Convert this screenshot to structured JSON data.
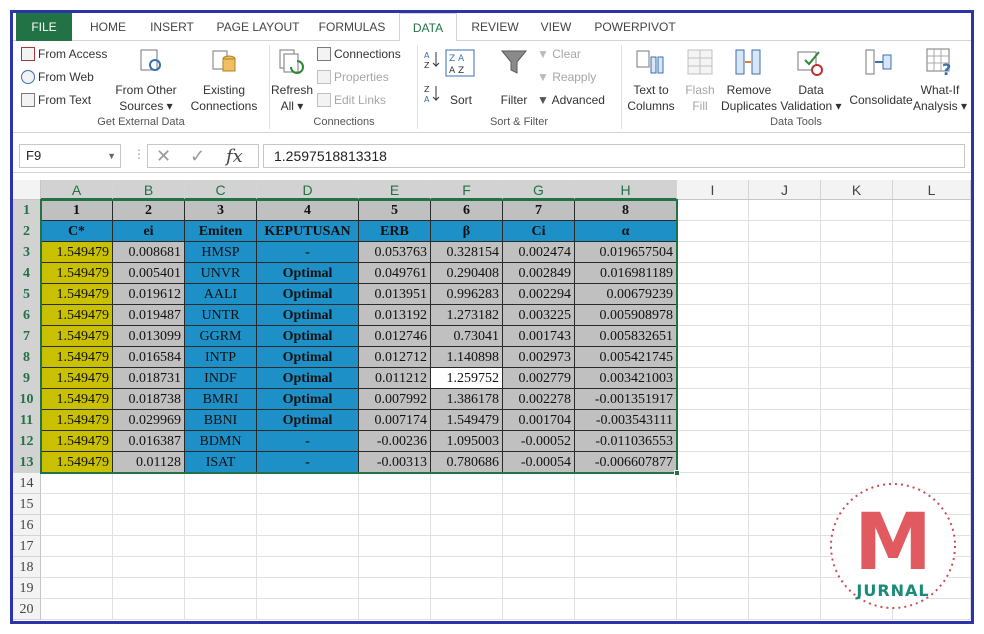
{
  "ribbon": {
    "tabs": [
      "FILE",
      "HOME",
      "INSERT",
      "PAGE LAYOUT",
      "FORMULAS",
      "DATA",
      "REVIEW",
      "VIEW",
      "POWERPIVOT"
    ],
    "get_external": {
      "from_access": "From Access",
      "from_web": "From Web",
      "from_text": "From Text",
      "from_other_1": "From Other",
      "from_other_2": "Sources ▾",
      "existing_1": "Existing",
      "existing_2": "Connections",
      "label": "Get External Data"
    },
    "connections": {
      "refresh_1": "Refresh",
      "refresh_2": "All ▾",
      "connections": "Connections",
      "properties": "Properties",
      "edit_links": "Edit Links",
      "label": "Connections"
    },
    "sort_filter": {
      "sort": "Sort",
      "filter": "Filter",
      "clear": "Clear",
      "reapply": "Reapply",
      "advanced": "Advanced",
      "label": "Sort & Filter"
    },
    "data_tools": {
      "text_to_1": "Text to",
      "text_to_2": "Columns",
      "flash_1": "Flash",
      "flash_2": "Fill",
      "remove_1": "Remove",
      "remove_2": "Duplicates",
      "validation_1": "Data",
      "validation_2": "Validation ▾",
      "consolidate": "Consolidate",
      "whatif_1": "What-If",
      "whatif_2": "Analysis ▾",
      "label": "Data Tools"
    }
  },
  "formula_bar": {
    "name_box": "F9",
    "fx": "fx",
    "value": "1.2597518813318"
  },
  "columns": [
    "A",
    "B",
    "C",
    "D",
    "E",
    "F",
    "G",
    "H",
    "I",
    "J",
    "K",
    "L"
  ],
  "rows": [
    "1",
    "2",
    "3",
    "4",
    "5",
    "6",
    "7",
    "8",
    "9",
    "10",
    "11",
    "12",
    "13",
    "14",
    "15",
    "16",
    "17",
    "18",
    "19",
    "20"
  ],
  "table": {
    "numbers": [
      "1",
      "2",
      "3",
      "4",
      "5",
      "6",
      "7",
      "8"
    ],
    "headers": [
      "C*",
      "ei",
      "Emiten",
      "KEPUTUSAN",
      "ERB",
      "β",
      "Ci",
      "α"
    ],
    "rows": [
      [
        "1.549479",
        "0.008681",
        "HMSP",
        "-",
        "0.053763",
        "0.328154",
        "0.002474",
        "0.019657504"
      ],
      [
        "1.549479",
        "0.005401",
        "UNVR",
        "Optimal",
        "0.049761",
        "0.290408",
        "0.002849",
        "0.016981189"
      ],
      [
        "1.549479",
        "0.019612",
        "AALI",
        "Optimal",
        "0.013951",
        "0.996283",
        "0.002294",
        "0.00679239"
      ],
      [
        "1.549479",
        "0.019487",
        "UNTR",
        "Optimal",
        "0.013192",
        "1.273182",
        "0.003225",
        "0.005908978"
      ],
      [
        "1.549479",
        "0.013099",
        "GGRM",
        "Optimal",
        "0.012746",
        "0.73041",
        "0.001743",
        "0.005832651"
      ],
      [
        "1.549479",
        "0.016584",
        "INTP",
        "Optimal",
        "0.012712",
        "1.140898",
        "0.002973",
        "0.005421745"
      ],
      [
        "1.549479",
        "0.018731",
        "INDF",
        "Optimal",
        "0.011212",
        "1.259752",
        "0.002779",
        "0.003421003"
      ],
      [
        "1.549479",
        "0.018738",
        "BMRI",
        "Optimal",
        "0.007992",
        "1.386178",
        "0.002278",
        "-0.001351917"
      ],
      [
        "1.549479",
        "0.029969",
        "BBNI",
        "Optimal",
        "0.007174",
        "1.549479",
        "0.001704",
        "-0.003543111"
      ],
      [
        "1.549479",
        "0.016387",
        "BDMN",
        "-",
        "-0.00236",
        "1.095003",
        "-0.00052",
        "-0.011036553"
      ],
      [
        "1.549479",
        "0.01128",
        "ISAT",
        "-",
        "-0.00313",
        "0.780686",
        "-0.00054",
        "-0.006607877"
      ]
    ]
  },
  "colors": {
    "accent": "#217346",
    "header_blue": "#1e90c8",
    "yellow": "#c8c000",
    "gray": "#c0c0c0",
    "frame": "#2b34a8"
  },
  "logo": {
    "letter": "M",
    "text": "JURNAL"
  }
}
